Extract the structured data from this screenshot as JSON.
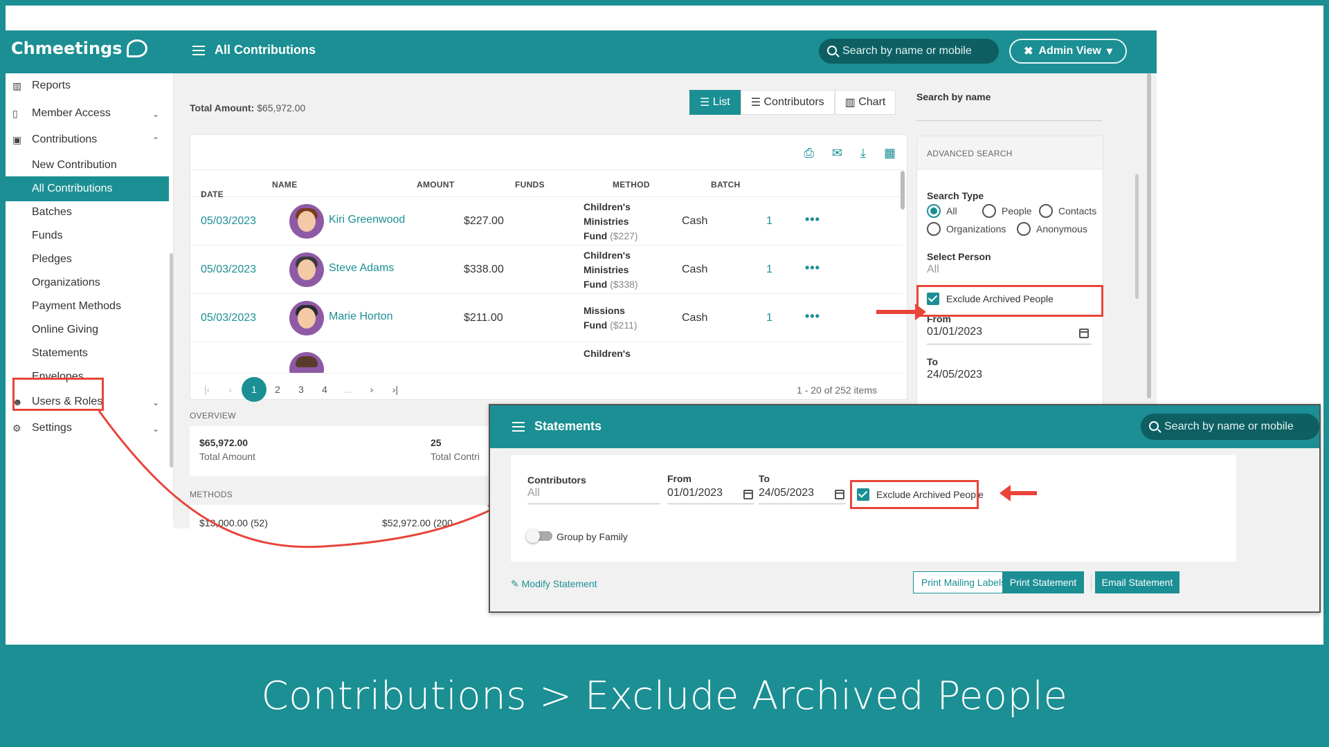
{
  "app": {
    "logo": "Chmeetings",
    "page_title": "All Contributions",
    "search_placeholder": "Search by name or mobile",
    "admin_view": "Admin View"
  },
  "sidebar": {
    "items": [
      {
        "label": "Reports",
        "icon": "bar-chart-icon"
      },
      {
        "label": "Member Access",
        "icon": "mobile-icon"
      },
      {
        "label": "Contributions",
        "icon": "money-icon"
      },
      {
        "label": "New Contribution"
      },
      {
        "label": "All Contributions"
      },
      {
        "label": "Batches"
      },
      {
        "label": "Funds"
      },
      {
        "label": "Pledges"
      },
      {
        "label": "Organizations"
      },
      {
        "label": "Payment Methods"
      },
      {
        "label": "Online Giving"
      },
      {
        "label": "Statements"
      },
      {
        "label": "Envelopes"
      },
      {
        "label": "Users & Roles",
        "icon": "users-icon"
      },
      {
        "label": "Settings",
        "icon": "gear-icon"
      }
    ]
  },
  "main": {
    "total_label": "Total Amount:",
    "total_value": "$65,972.00",
    "views": [
      "List",
      "Contributors",
      "Chart"
    ],
    "columns": [
      "DATE",
      "NAME",
      "AMOUNT",
      "FUNDS",
      "METHOD",
      "BATCH"
    ],
    "rows": [
      {
        "date": "05/03/2023",
        "name": "Kiri Greenwood",
        "amount": "$227.00",
        "fund_l1": "Children's",
        "fund_l2": "Ministries",
        "fund_l3": "Fund",
        "fund_amt": "($227)",
        "method": "Cash",
        "batch": "1"
      },
      {
        "date": "05/03/2023",
        "name": "Steve Adams",
        "amount": "$338.00",
        "fund_l1": "Children's",
        "fund_l2": "Ministries",
        "fund_l3": "Fund",
        "fund_amt": "($338)",
        "method": "Cash",
        "batch": "1"
      },
      {
        "date": "05/03/2023",
        "name": "Marie Horton",
        "amount": "$211.00",
        "fund_l1": "Missions",
        "fund_l2": "Fund",
        "fund_amt": "($211)",
        "method": "Cash",
        "batch": "1"
      }
    ],
    "next_row_fund": "Children's",
    "pages": [
      "1",
      "2",
      "3",
      "4",
      "..."
    ],
    "page_info": "1 - 20 of 252 items",
    "overview_label": "OVERVIEW",
    "overview_total_value": "$65,972.00",
    "overview_total_label": "Total Amount",
    "overview_count_value": "25",
    "overview_count_label": "Total Contri",
    "methods_label": "METHODS",
    "methods_a": "$13,000.00 (52)",
    "methods_b": "$52,972.00 (200"
  },
  "search_panel": {
    "title": "Search by name",
    "advanced": "ADVANCED SEARCH",
    "search_type": "Search Type",
    "types": [
      "All",
      "People",
      "Contacts",
      "Organizations",
      "Anonymous"
    ],
    "select_person": "Select Person",
    "select_person_value": "All",
    "exclude_archived": "Exclude Archived People",
    "from_label": "From",
    "from_value": "01/01/2023",
    "to_label": "To",
    "to_value": "24/05/2023"
  },
  "statements": {
    "title": "Statements",
    "search_placeholder": "Search by name or mobile",
    "contributors_label": "Contributors",
    "contributors_value": "All",
    "from_label": "From",
    "from_value": "01/01/2023",
    "to_label": "To",
    "to_value": "24/05/2023",
    "exclude_archived": "Exclude Archived People",
    "group_by_family": "Group by Family",
    "modify": "Modify Statement",
    "print_labels": "Print Mailing Labels",
    "print_statement": "Print Statement",
    "email_statement": "Email Statement"
  },
  "caption": "Contributions > Exclude Archived People",
  "colors": {
    "brand": "#1b8f93",
    "highlight": "#e8443a"
  }
}
